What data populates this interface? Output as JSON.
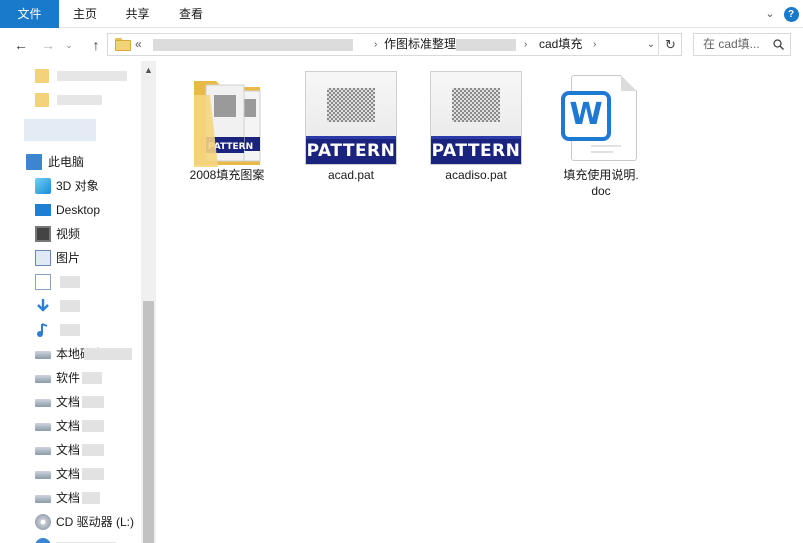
{
  "ribbon": {
    "tabs": [
      "文件",
      "主页",
      "共享",
      "查看"
    ],
    "expand_glyph": "⌄",
    "help_glyph": "?"
  },
  "nav": {
    "back_glyph": "←",
    "forward_glyph": "→",
    "recent_glyph": "⌄",
    "up_glyph": "↑",
    "breadcrumb": {
      "overflow": "«",
      "segments": [
        "作图标准整理",
        "cad填充"
      ],
      "separator": "›"
    },
    "refresh_glyph": "↻",
    "search_placeholder": "在 cad填..."
  },
  "sidebar": {
    "items": [
      {
        "label": "此电脑",
        "icon": "computer-icon"
      },
      {
        "label": "3D 对象",
        "icon": "3d-objects-icon"
      },
      {
        "label": "Desktop",
        "icon": "desktop-icon"
      },
      {
        "label": "视频",
        "icon": "video-icon"
      },
      {
        "label": "图片",
        "icon": "pictures-icon"
      },
      {
        "label": "",
        "icon": "documents-icon"
      },
      {
        "label": "",
        "icon": "downloads-icon"
      },
      {
        "label": "",
        "icon": "music-icon"
      },
      {
        "label": "本地磁盘",
        "icon": "drive-icon"
      },
      {
        "label": "软件",
        "icon": "drive-icon"
      },
      {
        "label": "文档",
        "icon": "drive-icon"
      },
      {
        "label": "文档",
        "icon": "drive-icon"
      },
      {
        "label": "文档",
        "icon": "drive-icon"
      },
      {
        "label": "文档",
        "icon": "drive-icon"
      },
      {
        "label": "文档",
        "icon": "drive-icon"
      },
      {
        "label": "CD 驱动器 (L:)",
        "icon": "cd-drive-icon"
      }
    ]
  },
  "content": {
    "files": [
      {
        "name": "2008填充图案",
        "type": "folder",
        "icon": "folder-icon"
      },
      {
        "name": "acad.pat",
        "type": "pat",
        "icon": "pattern-file-icon",
        "badge": "PATTERN"
      },
      {
        "name": "acadiso.pat",
        "type": "pat",
        "icon": "pattern-file-icon",
        "badge": "PATTERN"
      },
      {
        "name": "填充使用说明.\ndoc",
        "type": "doc",
        "icon": "wps-writer-icon",
        "badge": "W"
      }
    ]
  },
  "colors": {
    "file_tab_bg": "#1979ca",
    "pattern_band": "#1a237e",
    "wps_blue": "#1d79d4"
  }
}
